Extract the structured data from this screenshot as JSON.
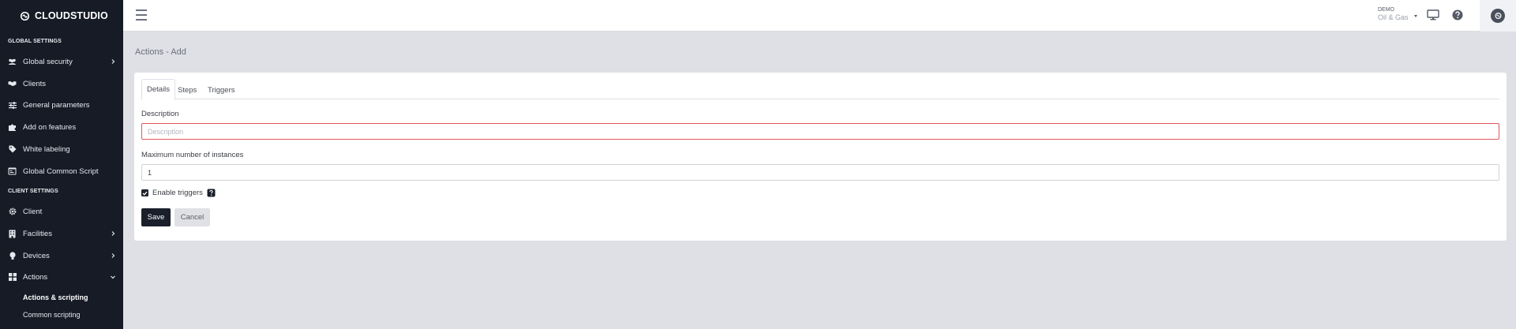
{
  "brand": {
    "name": "CLOUDSTUDIO"
  },
  "sidebar": {
    "global_section": "GLOBAL SETTINGS",
    "client_section": "CLIENT SETTINGS",
    "items": [
      {
        "label": "Global security",
        "icon": "users-icon",
        "chevron": "right"
      },
      {
        "label": "Clients",
        "icon": "handshake-icon"
      },
      {
        "label": "General parameters",
        "icon": "sliders-icon"
      },
      {
        "label": "Add on features",
        "icon": "puzzle-icon"
      },
      {
        "label": "White labeling",
        "icon": "tag-icon"
      },
      {
        "label": "Global Common Script",
        "icon": "code-icon"
      },
      {
        "label": "Client",
        "icon": "gear-icon"
      },
      {
        "label": "Facilities",
        "icon": "building-icon",
        "chevron": "right"
      },
      {
        "label": "Devices",
        "icon": "bulb-icon",
        "chevron": "right"
      },
      {
        "label": "Actions",
        "icon": "grid-icon",
        "chevron": "down"
      }
    ],
    "subitems": [
      {
        "label": "Actions & scripting",
        "active": true
      },
      {
        "label": "Common scripting",
        "active": false
      }
    ]
  },
  "topbar": {
    "org_top": "DEMO",
    "org_name": "Oil & Gas",
    "icons": [
      "hamburger-icon",
      "monitor-icon",
      "help-icon",
      "avatar-icon"
    ]
  },
  "page": {
    "title": "Actions - Add",
    "tabs": [
      {
        "label": "Details",
        "active": true
      },
      {
        "label": "Steps",
        "active": false
      },
      {
        "label": "Triggers",
        "active": false
      }
    ],
    "description_label": "Description",
    "description_placeholder": "Description",
    "description_value": "",
    "max_instances_label": "Maximum number of instances",
    "max_instances_value": "1",
    "enable_triggers_label": "Enable triggers",
    "enable_triggers_checked": true,
    "save_label": "Save",
    "cancel_label": "Cancel"
  },
  "colors": {
    "sidebar_bg": "#161b26",
    "content_bg": "#dfe0e5",
    "invalid_border": "#e0585b",
    "primary_button": "#1a1f2b"
  }
}
